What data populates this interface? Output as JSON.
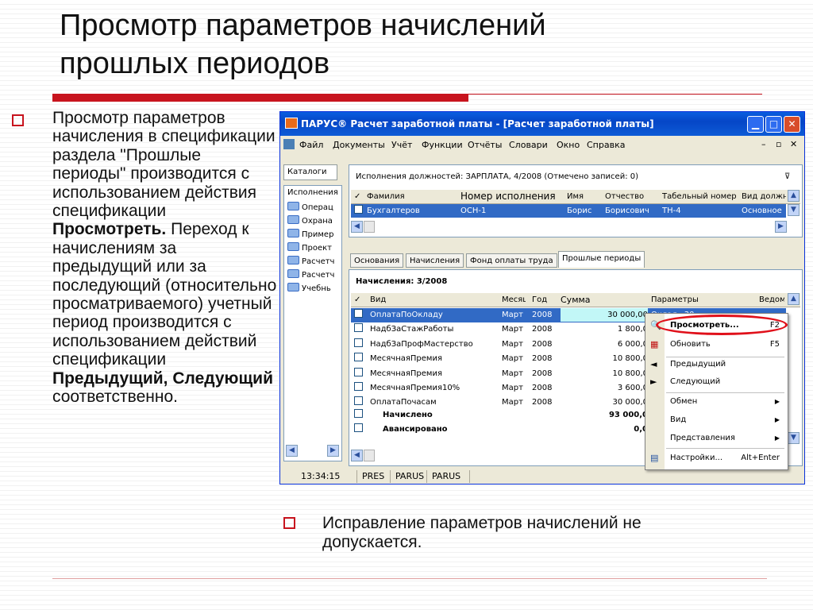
{
  "slide": {
    "title_line1": "Просмотр параметров начислений",
    "title_line2": "прошлых периодов",
    "left_bullet": {
      "part1": "Просмотр параметров начисления в спецификации раздела \"Прошлые периоды\" производится с использованием действия спецификации ",
      "bold1": "Просмотреть.",
      "part2": " Переход к начислениям за предыдущий или за последующий (относительно просматриваемого) учетный период производится с использованием действий спецификации ",
      "bold2": "Предыдущий, Следующий",
      "part3": " соответственно."
    },
    "right_bullet": "Исправление параметров начислений не допускается."
  },
  "window": {
    "title": "ПАРУС® Расчет заработной платы - [Расчет заработной платы]",
    "menu": [
      "Файл",
      "Документы",
      "Учёт",
      "Функции",
      "Отчёты",
      "Словари",
      "Окно",
      "Справка"
    ],
    "sidebar": {
      "tab": "Каталоги",
      "items": [
        "Исполнения",
        "Операц",
        "Охрана",
        "Пример",
        "Проект",
        "Расчетч",
        "Расчетч",
        "Учебнь"
      ]
    },
    "top_panel": {
      "header": "Исполнения должностей: ЗАРПЛАТА, 4/2008 (Отмечено записей: 0)",
      "columns": [
        "✓",
        "Фамилия",
        "Номер исполнения",
        "Имя",
        "Отчество",
        "Табельный номер",
        "Вид должн"
      ],
      "row": [
        "",
        "Бухгалтеров",
        "ОСН-1",
        "Борис",
        "Борисович",
        "ТН-4",
        "Основное"
      ]
    },
    "tabs": [
      "Основания",
      "Начисления",
      "Фонд оплаты труда",
      "Прошлые периоды"
    ],
    "bottom_panel": {
      "header": "Начисления: 3/2008",
      "columns": [
        "✓",
        "Вид",
        "Месяц",
        "Год",
        "Сумма",
        "Параметры",
        "Ведом"
      ],
      "rows": [
        {
          "vid": "ОплатаПоОкладу",
          "month": "Март",
          "year": "2008",
          "sum": "30 000,00",
          "params": "Оклад=30..."
        },
        {
          "vid": "НадбЗаСтажРаботы",
          "month": "Март",
          "year": "2008",
          "sum": "1 800,0",
          "params": ""
        },
        {
          "vid": "НадбЗаПрофМастерство",
          "month": "Март",
          "year": "2008",
          "sum": "6 000,0",
          "params": ""
        },
        {
          "vid": "МесячнаяПремия",
          "month": "Март",
          "year": "2008",
          "sum": "10 800,0",
          "params": ""
        },
        {
          "vid": "МесячнаяПремия",
          "month": "Март",
          "year": "2008",
          "sum": "10 800,0",
          "params": ""
        },
        {
          "vid": "МесячнаяПремия10%",
          "month": "Март",
          "year": "2008",
          "sum": "3 600,0",
          "params": ""
        },
        {
          "vid": "ОплатаПочасам",
          "month": "Март",
          "year": "2008",
          "sum": "30 000,0",
          "params": ""
        }
      ],
      "total_accrued_label": "Начислено",
      "total_accrued": "93 000,0",
      "total_advance_label": "Авансировано",
      "total_advance": "0,0"
    },
    "context_menu": {
      "view": "Просмотреть...",
      "view_key": "F2",
      "refresh": "Обновить",
      "refresh_key": "F5",
      "prev": "Предыдущий",
      "next": "Следующий",
      "exchange": "Обмен",
      "vid": "Вид",
      "views": "Представления",
      "settings": "Настройки...",
      "settings_key": "Alt+Enter"
    },
    "status": {
      "time": "13:34:15",
      "seg1": "PRES",
      "seg2": "PARUS",
      "seg3": "PARUS"
    }
  }
}
